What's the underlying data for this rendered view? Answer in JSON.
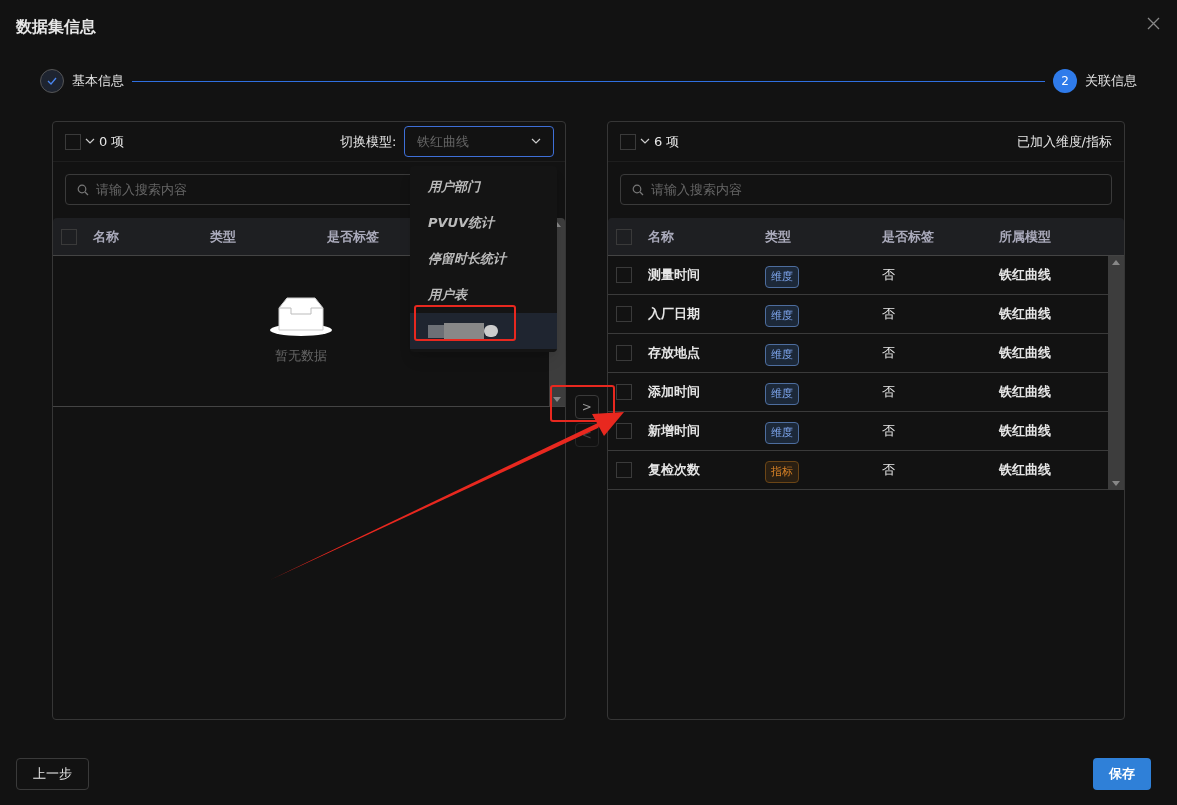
{
  "dialog": {
    "title": "数据集信息"
  },
  "steps": [
    {
      "label": "基本信息",
      "done": true
    },
    {
      "number": "2",
      "label": "关联信息",
      "done": false
    }
  ],
  "source_panel": {
    "select_all": {
      "checked": false
    },
    "count": "0 项",
    "model_label": "切换模型:",
    "model_select": {
      "placeholder": "铁红曲线",
      "focused": true
    },
    "search": {
      "placeholder": "请输入搜索内容"
    },
    "header_checked": false,
    "columns": [
      "名称",
      "类型",
      "是否标签"
    ],
    "empty_text": "暂无数据"
  },
  "model_dropdown": {
    "options": [
      {
        "kind": "text",
        "label": "用户部门",
        "selected": false
      },
      {
        "kind": "text",
        "label": "PVUV统计",
        "selected": false
      },
      {
        "kind": "text",
        "label": "停留时长统计",
        "selected": false
      },
      {
        "kind": "text",
        "label": "用户表",
        "selected": false
      },
      {
        "kind": "redacted",
        "selected": true
      }
    ]
  },
  "transfer_buttons": [
    {
      "symbol": ">",
      "disabled": false
    },
    {
      "symbol": "<",
      "disabled": true
    }
  ],
  "target_panel": {
    "select_all": {
      "checked": false
    },
    "count": "6 项",
    "title": "已加入维度/指标",
    "search": {
      "placeholder": "请输入搜索内容"
    },
    "header_checked": false,
    "columns": [
      "名称",
      "类型",
      "是否标签",
      "所属模型"
    ],
    "rows": [
      {
        "checked": false,
        "name": "测量时间",
        "type": {
          "kind": "dimension",
          "label": "维度"
        },
        "is_tag": "否",
        "model": "铁红曲线"
      },
      {
        "checked": false,
        "name": "入厂日期",
        "type": {
          "kind": "dimension",
          "label": "维度"
        },
        "is_tag": "否",
        "model": "铁红曲线"
      },
      {
        "checked": false,
        "name": "存放地点",
        "type": {
          "kind": "dimension",
          "label": "维度"
        },
        "is_tag": "否",
        "model": "铁红曲线"
      },
      {
        "checked": false,
        "name": "添加时间",
        "type": {
          "kind": "dimension",
          "label": "维度"
        },
        "is_tag": "否",
        "model": "铁红曲线"
      },
      {
        "checked": false,
        "name": "新增时间",
        "type": {
          "kind": "dimension",
          "label": "维度"
        },
        "is_tag": "否",
        "model": "铁红曲线"
      },
      {
        "checked": false,
        "name": "复检次数",
        "type": {
          "kind": "metric",
          "label": "指标"
        },
        "is_tag": "否",
        "model": "铁红曲线"
      }
    ]
  },
  "footer": {
    "back": "上一步",
    "save": "保存"
  }
}
